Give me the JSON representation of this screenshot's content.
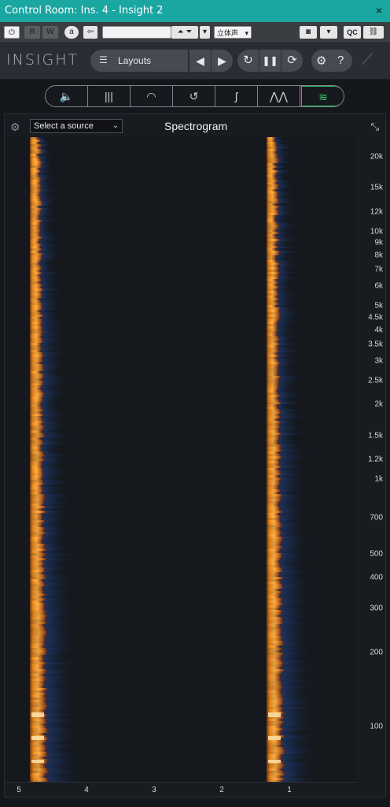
{
  "window": {
    "title": "Control Room: Ins. 4 - Insight 2",
    "close": "×"
  },
  "host_toolbar": {
    "power": "⏻",
    "read": "R",
    "write": "W",
    "auto": "a",
    "compare": "⇦",
    "preset_field": "",
    "arrows": "⏶ ⏷",
    "preset_menu": "▾",
    "channel": "立体声",
    "channel_menu": "▾",
    "camera": "◙",
    "camera_menu": "▾",
    "qc": "QC",
    "link": "⛓"
  },
  "header": {
    "logo": "INSIGHT",
    "layouts_label": "Layouts",
    "layouts_icon": "☰",
    "prev": "◀",
    "next": "▶",
    "reset": "↻",
    "pause": "❚❚",
    "capture": "⟳",
    "settings": "⚙",
    "help": "?",
    "brand": "⟋"
  },
  "tabs": [
    {
      "name": "loudness",
      "glyph": "🔈"
    },
    {
      "name": "levels",
      "glyph": "|||"
    },
    {
      "name": "meter",
      "glyph": "◠"
    },
    {
      "name": "history",
      "glyph": "↺"
    },
    {
      "name": "listening",
      "glyph": "ʃ"
    },
    {
      "name": "spectrum",
      "glyph": "⋀⋀"
    },
    {
      "name": "spectrogram",
      "glyph": "≋"
    }
  ],
  "panel": {
    "gear": "⚙",
    "source_label": "Select a source",
    "source_chevron": "⌄",
    "title": "Spectrogram",
    "expand": "⤡"
  },
  "frequency_axis": [
    "20k",
    "15k",
    "12k",
    "10k",
    "9k",
    "8k",
    "7k",
    "6k",
    "5k",
    "4.5k",
    "4k",
    "3.5k",
    "3k",
    "2.5k",
    "2k",
    "1.5k",
    "1.2k",
    "1k",
    "700",
    "500",
    "400",
    "300",
    "200",
    "100"
  ],
  "time_axis": [
    "5",
    "4",
    "3",
    "2",
    "1"
  ],
  "colors": {
    "accent": "#2dbf62",
    "titlebar": "#1aa6a1",
    "hot": "#ff9a2a",
    "cool": "#1e3a6e"
  }
}
